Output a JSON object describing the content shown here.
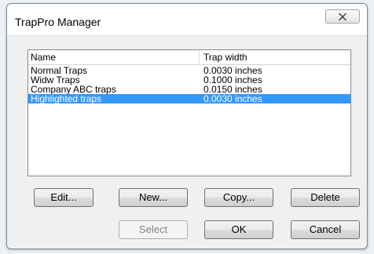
{
  "window": {
    "title": "TrapPro Manager"
  },
  "list": {
    "columns": [
      "Name",
      "Trap width"
    ],
    "rows": [
      {
        "name": "Normal Traps",
        "width": "0.0030 inches",
        "selected": false
      },
      {
        "name": "Widw Traps",
        "width": "0.1000 inches",
        "selected": false
      },
      {
        "name": "Company ABC traps",
        "width": "0.0150 inches",
        "selected": false
      },
      {
        "name": "Highlighted traps",
        "width": "0.0030 inches",
        "selected": true
      }
    ]
  },
  "buttons": {
    "edit": "Edit...",
    "new": "New...",
    "copy": "Copy...",
    "delete": "Delete",
    "select": "Select",
    "ok": "OK",
    "cancel": "Cancel"
  },
  "colors": {
    "selection": "#3399ff",
    "dialog_bg": "#f0f0f0"
  },
  "icons": {
    "close": "close-icon"
  }
}
